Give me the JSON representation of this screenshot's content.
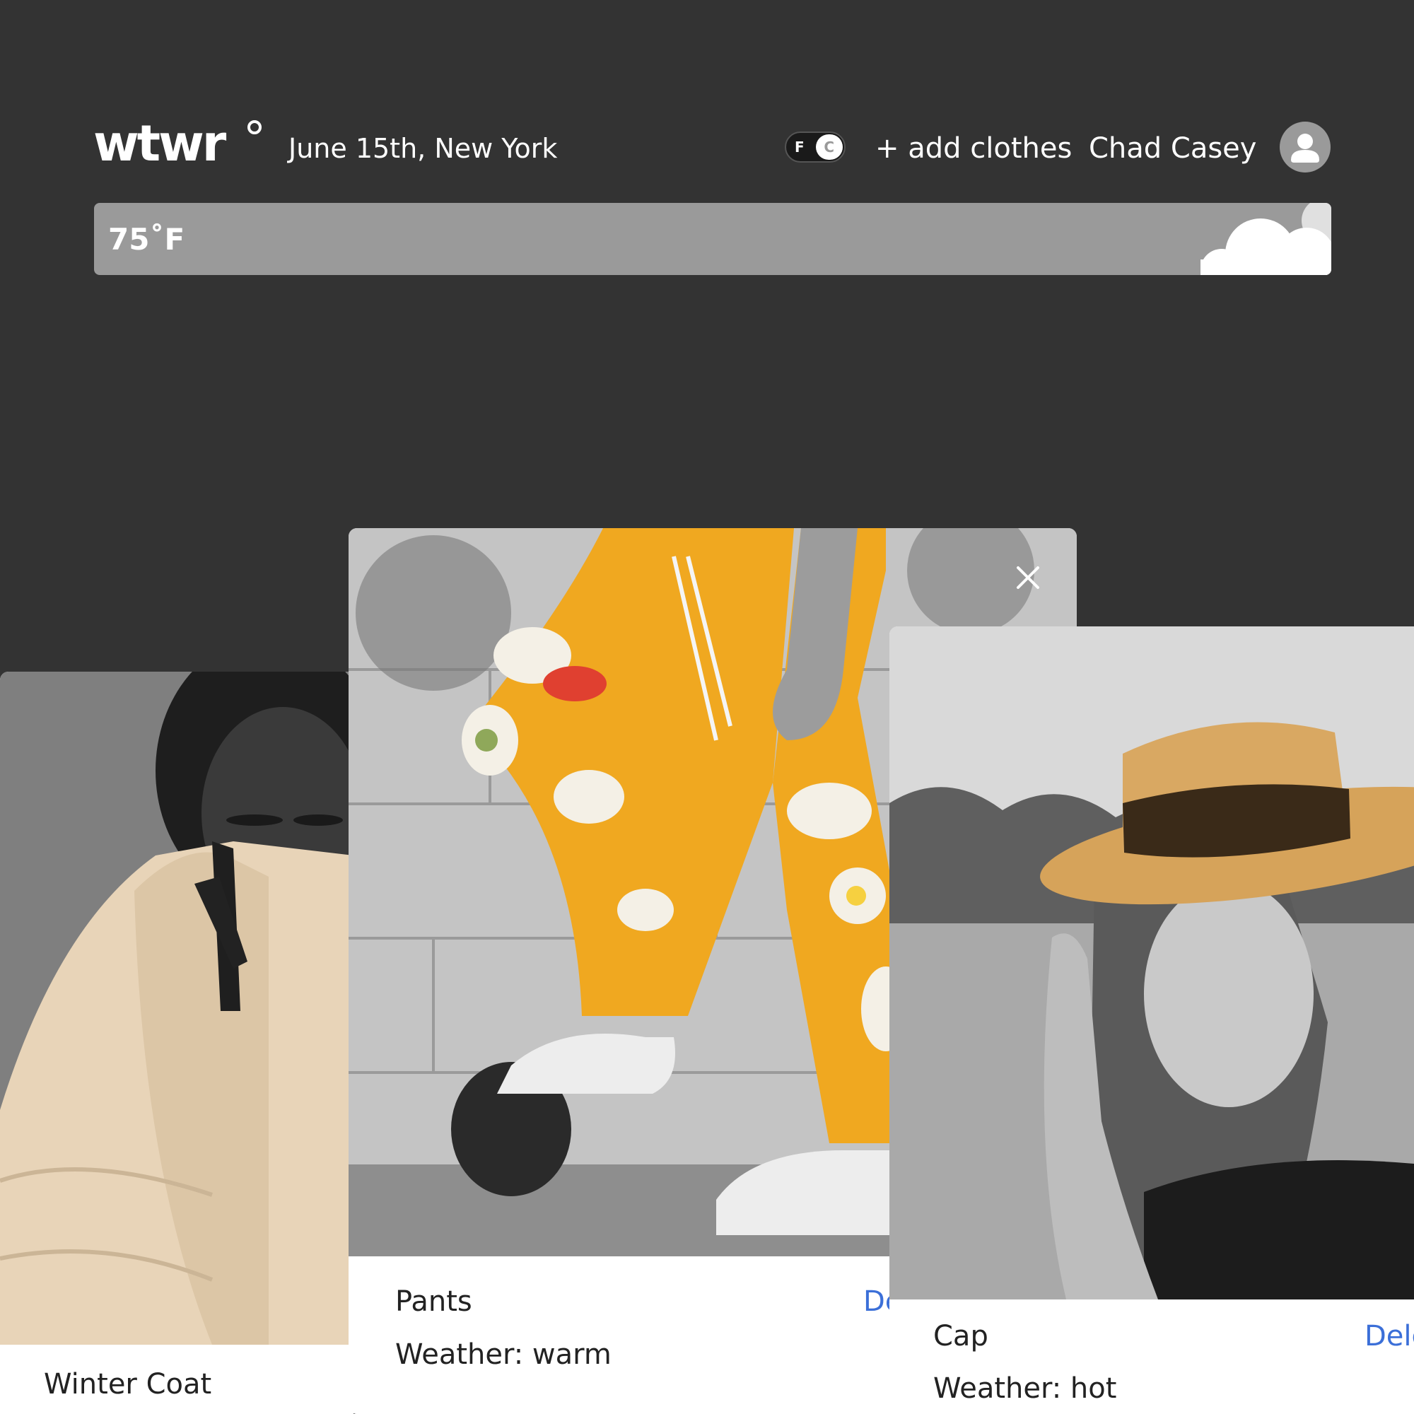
{
  "header": {
    "logo": "wtwr",
    "date_location": "June 15th, New York",
    "unit_toggle": {
      "left": "F",
      "right": "C",
      "selected": "F"
    },
    "add_clothes": "+ add clothes",
    "username": "Chad Casey"
  },
  "weather": {
    "temperature": "75˚F",
    "icon": "cloud-icon"
  },
  "cards": [
    {
      "title": "Winter Coat",
      "image": "photo of person in beige puffer jacket"
    },
    {
      "title": "Pants",
      "weather": "Weather: warm",
      "delete": "De",
      "close_icon": "close-icon",
      "image": "photo of orange patterned pants"
    },
    {
      "title": "Cap",
      "weather": "Weather: hot",
      "delete": "Dele",
      "image": "photo of woman in straw hat"
    }
  ],
  "colors": {
    "background": "#333333",
    "weather_bar": "#9a9a9a",
    "card": "#ffffff",
    "delete_link": "#3b6fd8",
    "pants": "#f0a820",
    "coat": "#e8d4b8"
  }
}
